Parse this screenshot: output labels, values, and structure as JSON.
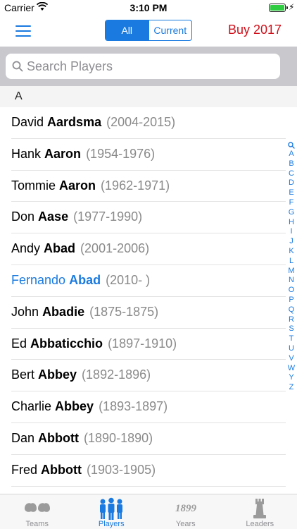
{
  "status_bar": {
    "carrier": "Carrier",
    "time": "3:10 PM",
    "icons": [
      "wifi-icon",
      "battery-icon",
      "charging-icon"
    ]
  },
  "nav": {
    "menu_icon": "menu-icon",
    "segments": [
      {
        "label": "All",
        "active": true
      },
      {
        "label": "Current",
        "active": false
      }
    ],
    "buy_label": "Buy 2017"
  },
  "search": {
    "placeholder": "Search Players",
    "value": ""
  },
  "section": {
    "letter": "A"
  },
  "players": [
    {
      "first": "David",
      "last": "Aardsma",
      "years": "(2004-2015)"
    },
    {
      "first": "Hank",
      "last": "Aaron",
      "years": "(1954-1976)"
    },
    {
      "first": "Tommie",
      "last": "Aaron",
      "years": "(1962-1971)"
    },
    {
      "first": "Don",
      "last": "Aase",
      "years": "(1977-1990)"
    },
    {
      "first": "Andy",
      "last": "Abad",
      "years": "(2001-2006)"
    },
    {
      "first": "Fernando",
      "last": "Abad",
      "years": "(2010- )",
      "selected": true
    },
    {
      "first": "John",
      "last": "Abadie",
      "years": "(1875-1875)"
    },
    {
      "first": "Ed",
      "last": "Abbaticchio",
      "years": "(1897-1910)"
    },
    {
      "first": "Bert",
      "last": "Abbey",
      "years": "(1892-1896)"
    },
    {
      "first": "Charlie",
      "last": "Abbey",
      "years": "(1893-1897)"
    },
    {
      "first": "Dan",
      "last": "Abbott",
      "years": "(1890-1890)"
    },
    {
      "first": "Fred",
      "last": "Abbott",
      "years": "(1903-1905)"
    }
  ],
  "index_letters": [
    "A",
    "B",
    "C",
    "D",
    "E",
    "F",
    "G",
    "H",
    "I",
    "J",
    "K",
    "L",
    "M",
    "N",
    "O",
    "P",
    "Q",
    "R",
    "S",
    "T",
    "U",
    "V",
    "W",
    "Y",
    "Z"
  ],
  "tabs": [
    {
      "label": "Teams",
      "icon": "teams-icon",
      "active": false
    },
    {
      "label": "Players",
      "icon": "players-icon",
      "active": true
    },
    {
      "label": "Years",
      "icon": "years-icon",
      "active": false,
      "icon_text": "1899"
    },
    {
      "label": "Leaders",
      "icon": "leaders-icon",
      "active": false
    }
  ],
  "colors": {
    "accent": "#1a7ae0",
    "buy": "#d0101a",
    "secondary_text": "#8a8a8a"
  }
}
